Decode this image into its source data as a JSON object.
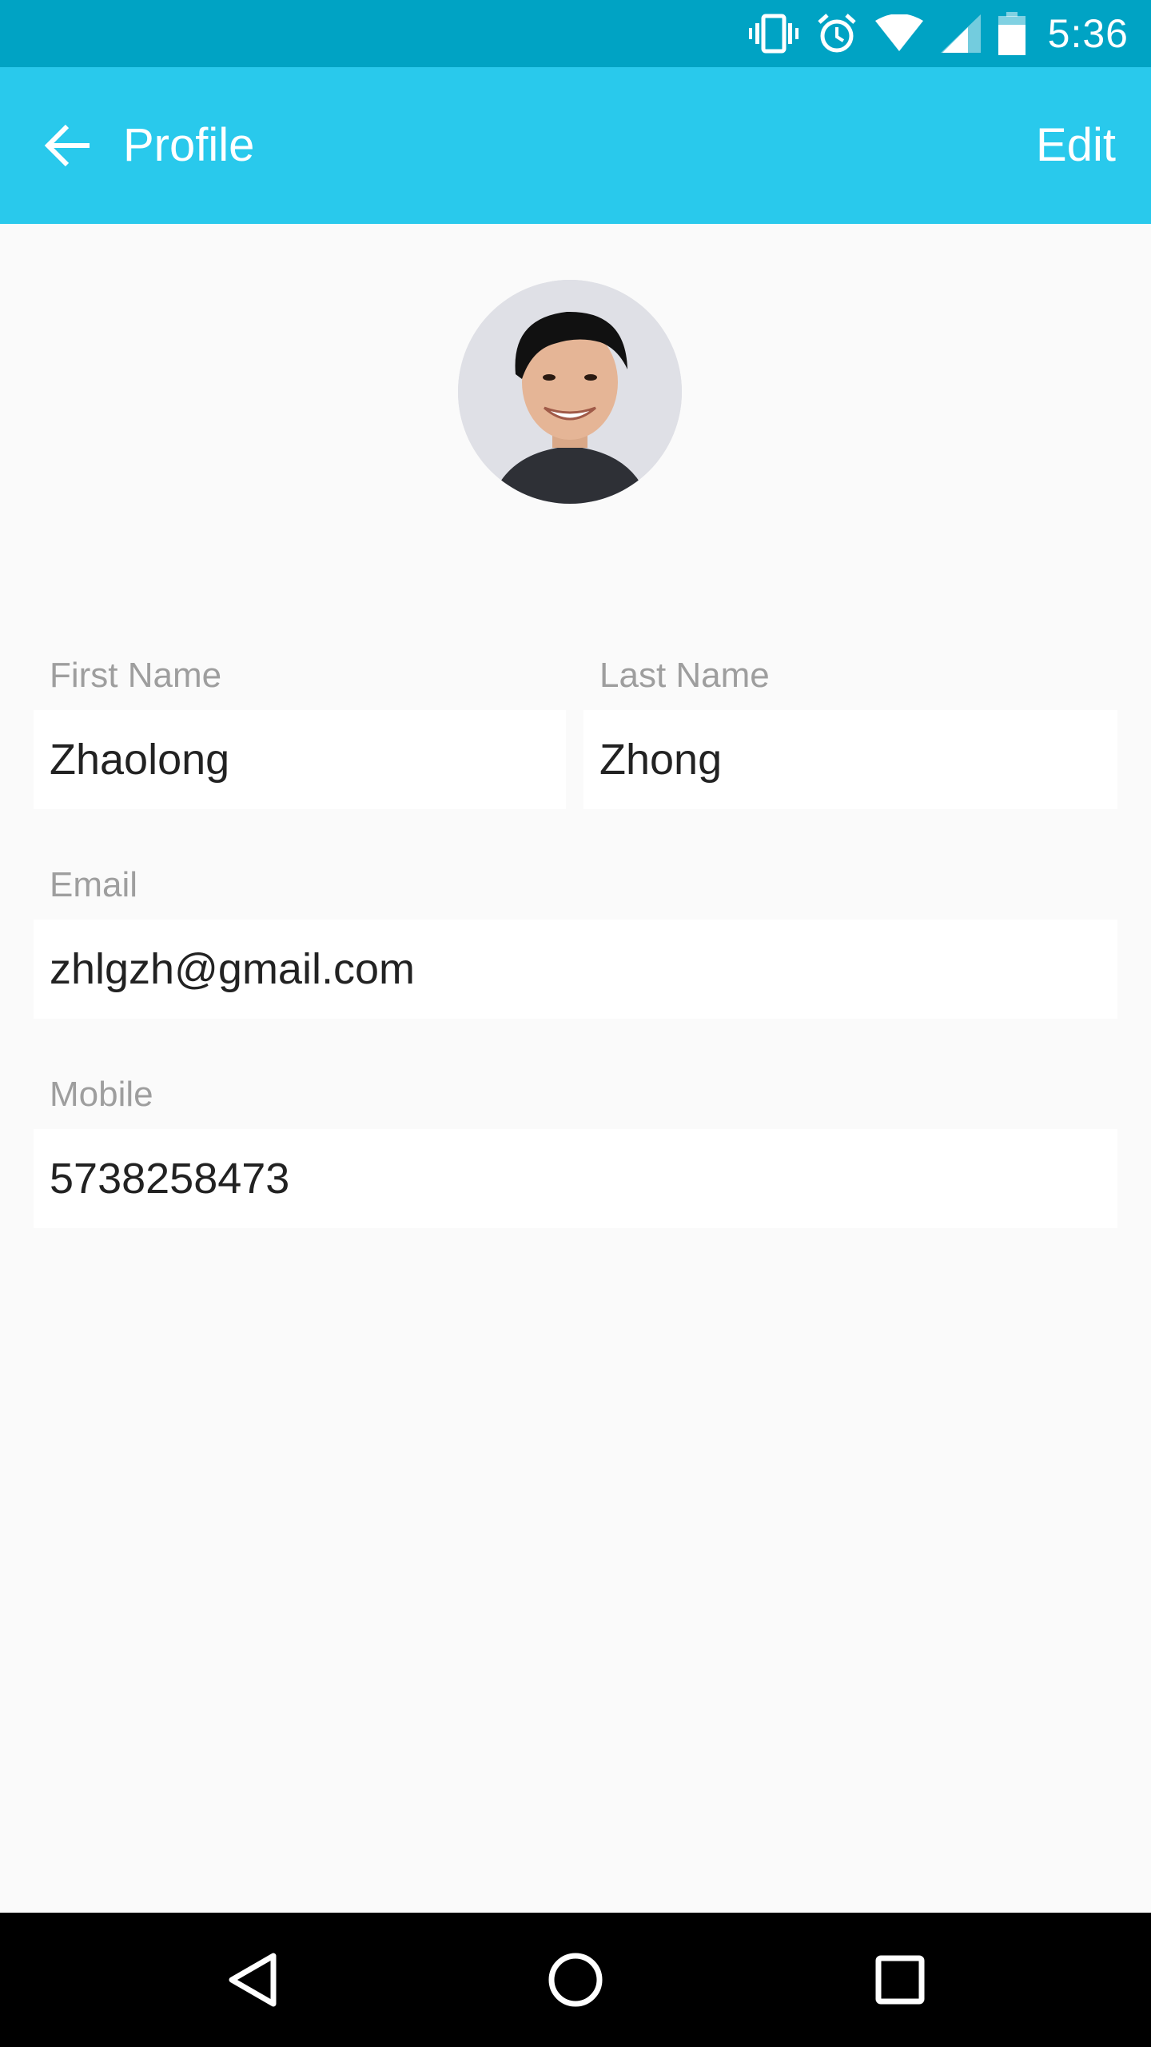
{
  "status_bar": {
    "time": "5:36",
    "icons": [
      "vibrate-icon",
      "alarm-icon",
      "wifi-icon",
      "signal-icon",
      "battery-icon"
    ]
  },
  "app_bar": {
    "title": "Profile",
    "action_label": "Edit",
    "back_icon": "arrow-back-icon",
    "color": "#29c9ec"
  },
  "profile": {
    "first_name_label": "First Name",
    "first_name_value": "Zhaolong",
    "last_name_label": "Last Name",
    "last_name_value": "Zhong",
    "email_label": "Email",
    "email_value": "zhlgzh@gmail.com",
    "mobile_label": "Mobile",
    "mobile_value": "5738258473"
  },
  "nav_bar": {
    "icons": [
      "back-triangle-icon",
      "home-circle-icon",
      "recents-square-icon"
    ]
  },
  "colors": {
    "status_bar": "#00a3c4",
    "app_bar": "#29c9ec",
    "background": "#fafafa",
    "label": "#9e9e9e"
  }
}
